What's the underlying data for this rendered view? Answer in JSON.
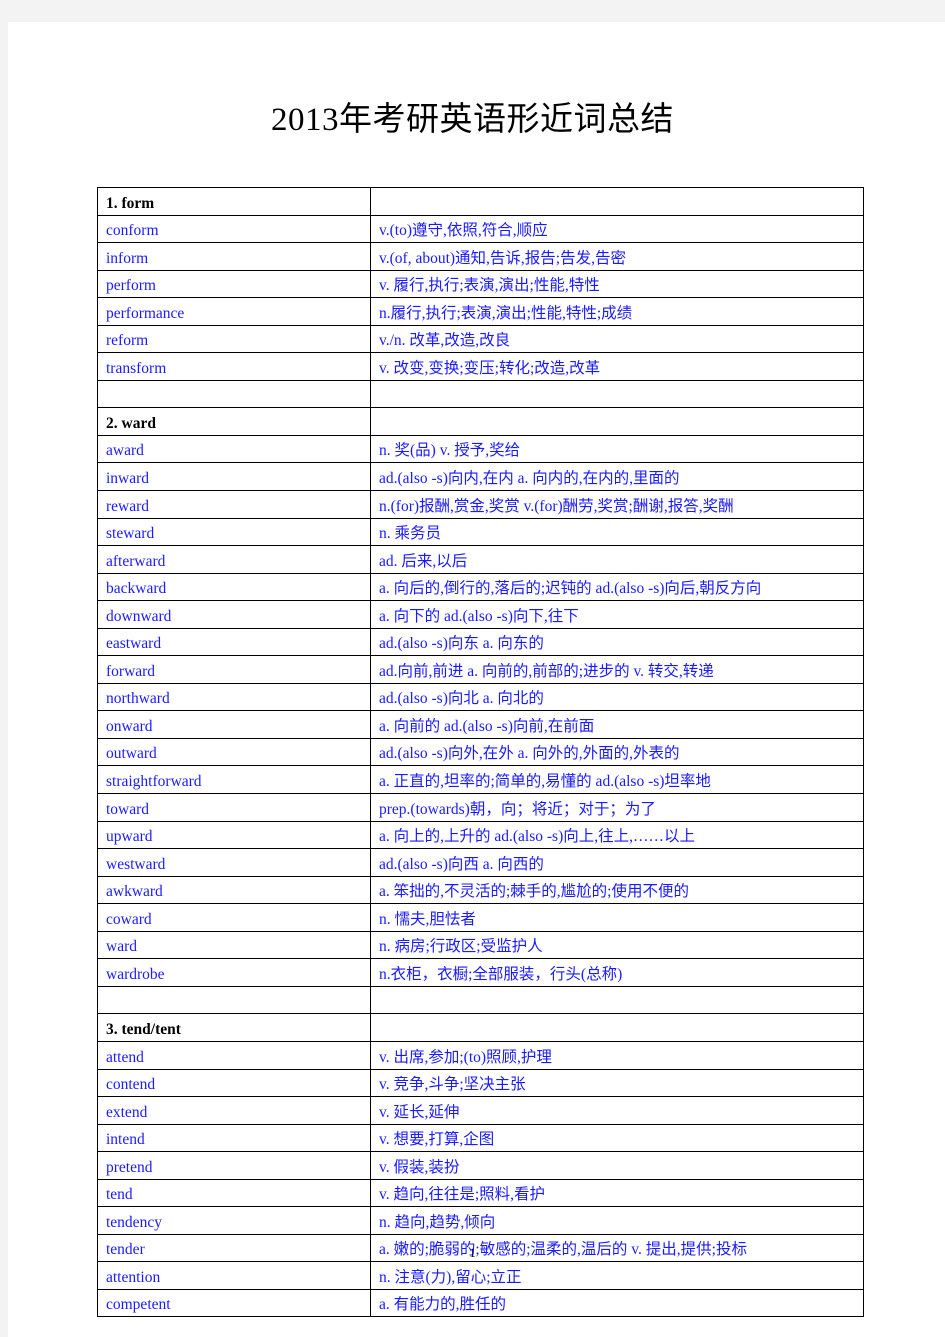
{
  "document": {
    "title": "2013年考研英语形近词总结",
    "page_number": "1",
    "link_color": "#1a1aff"
  },
  "sections": [
    {
      "heading": "1. form",
      "rows": [
        {
          "word": "conform",
          "definition": "v.(to)遵守,依照,符合,顺应"
        },
        {
          "word": "inform",
          "definition": "v.(of,  about)通知,告诉,报告;告发,告密"
        },
        {
          "word": "perform",
          "definition": "v.  履行,执行;表演,演出;性能,特性"
        },
        {
          "word": "performance",
          "definition": "n.履行,执行;表演,演出;性能,特性;成绩"
        },
        {
          "word": "reform",
          "definition": "v./n.  改革,改造,改良"
        },
        {
          "word": "transform",
          "definition": "v.  改变,变换;变压;转化;改造,改革"
        }
      ]
    },
    {
      "heading": "2. ward",
      "rows": [
        {
          "word": "award",
          "definition": "n.  奖(品) v.  授予,奖给"
        },
        {
          "word": "inward",
          "definition": "ad.(also  -s)向内,在内  a.  向内的,在内的,里面的"
        },
        {
          "word": "reward",
          "definition": "n.(for)报酬,赏金,奖赏  v.(for)酬劳,奖赏;酬谢,报答,奖酬"
        },
        {
          "word": "steward",
          "definition": "n.  乘务员"
        },
        {
          "word": "afterward",
          "definition": "ad.  后来,以后"
        },
        {
          "word": "backward",
          "definition": "a.  向后的,倒行的,落后的;迟钝的  ad.(also  -s)向后,朝反方向"
        },
        {
          "word": "downward",
          "definition": "a.  向下的  ad.(also  -s)向下,往下"
        },
        {
          "word": "eastward",
          "definition": "ad.(also  -s)向东  a.  向东的"
        },
        {
          "word": "forward",
          "definition": "ad.向前,前进  a.  向前的,前部的;进步的  v.  转交,转递"
        },
        {
          "word": "northward",
          "definition": "ad.(also  -s)向北  a.  向北的"
        },
        {
          "word": "onward",
          "definition": "a.  向前的  ad.(also  -s)向前,在前面"
        },
        {
          "word": "outward",
          "definition": "ad.(also  -s)向外,在外  a.  向外的,外面的,外表的"
        },
        {
          "word": "straightforward",
          "definition": "a.  正直的,坦率的;简单的,易懂的  ad.(also  -s)坦率地"
        },
        {
          "word": "toward",
          "definition": "prep.(towards)朝，向；将近；对于；为了"
        },
        {
          "word": "upward",
          "definition": "a.  向上的,上升的  ad.(also  -s)向上,往上,……以上"
        },
        {
          "word": "westward",
          "definition": "ad.(also  -s)向西  a.  向西的"
        },
        {
          "word": "awkward",
          "definition": "a.  笨拙的,不灵活的;棘手的,尴尬的;使用不便的"
        },
        {
          "word": "coward",
          "definition": "n.  懦夫,胆怯者"
        },
        {
          "word": "ward",
          "definition": "n.  病房;行政区;受监护人"
        },
        {
          "word": "wardrobe",
          "definition": "n.衣柜，衣橱;全部服装，行头(总称)"
        }
      ]
    },
    {
      "heading": "3. tend/tent",
      "rows": [
        {
          "word": "attend",
          "definition": "v.  出席,参加;(to)照顾,护理"
        },
        {
          "word": "contend",
          "definition": "v.  竞争,斗争;坚决主张"
        },
        {
          "word": "extend",
          "definition": "v.  延长,延伸"
        },
        {
          "word": "intend",
          "definition": "v.  想要,打算,企图"
        },
        {
          "word": "pretend",
          "definition": "v.  假装,装扮"
        },
        {
          "word": "tend",
          "definition": "v.  趋向,往往是;照料,看护"
        },
        {
          "word": "tendency",
          "definition": "n.  趋向,趋势,倾向"
        },
        {
          "word": "tender",
          "definition": "a.  嫩的;脆弱的;敏感的;温柔的,温后的  v.  提出,提供;投标"
        },
        {
          "word": "attention",
          "definition": "n.  注意(力),留心;立正"
        },
        {
          "word": "competent",
          "definition": "a.  有能力的,胜任的"
        }
      ]
    }
  ]
}
